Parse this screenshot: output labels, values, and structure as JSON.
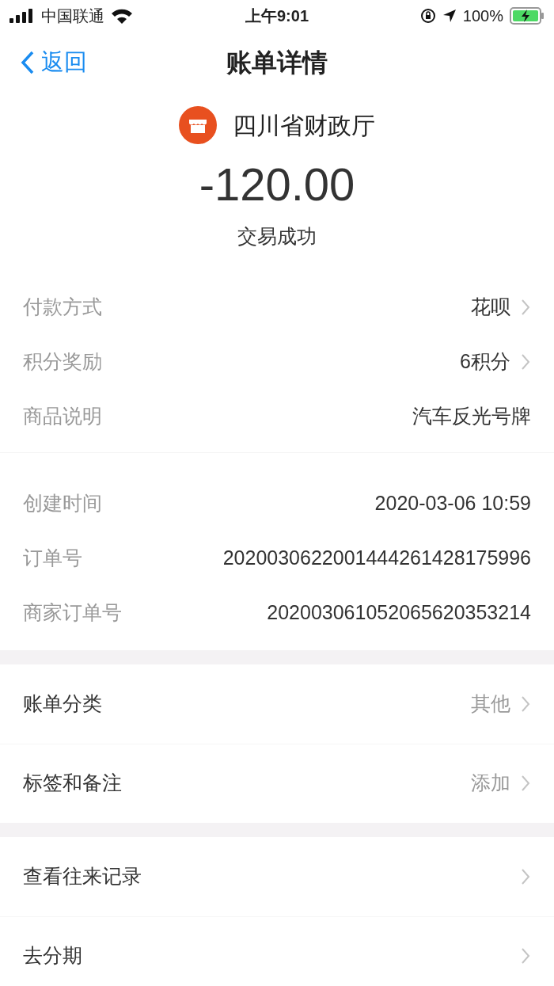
{
  "status_bar": {
    "carrier": "中国联通",
    "time": "上午9:01",
    "battery": "100%",
    "charging": true
  },
  "nav": {
    "back": "返回",
    "title": "账单详情"
  },
  "merchant": {
    "name": "四川省财政厅"
  },
  "amount": "-120.00",
  "status": "交易成功",
  "detail_groups": [
    [
      {
        "label": "付款方式",
        "value": "花呗",
        "chevron": true
      },
      {
        "label": "积分奖励",
        "value": "6积分",
        "chevron": true
      },
      {
        "label": "商品说明",
        "value": "汽车反光号牌",
        "chevron": false
      }
    ],
    [
      {
        "label": "创建时间",
        "value": "2020-03-06 10:59",
        "chevron": false
      },
      {
        "label": "订单号",
        "value": "2020030622001444261428175996",
        "chevron": false
      },
      {
        "label": "商家订单号",
        "value": "202003061052065620353214",
        "chevron": false
      }
    ]
  ],
  "action_groups": [
    [
      {
        "label": "账单分类",
        "value": "其他",
        "chevron": true
      },
      {
        "label": "标签和备注",
        "value": "添加",
        "chevron": true
      }
    ],
    [
      {
        "label": "查看往来记录",
        "chevron": true
      },
      {
        "label": "去分期",
        "chevron": true
      }
    ]
  ]
}
